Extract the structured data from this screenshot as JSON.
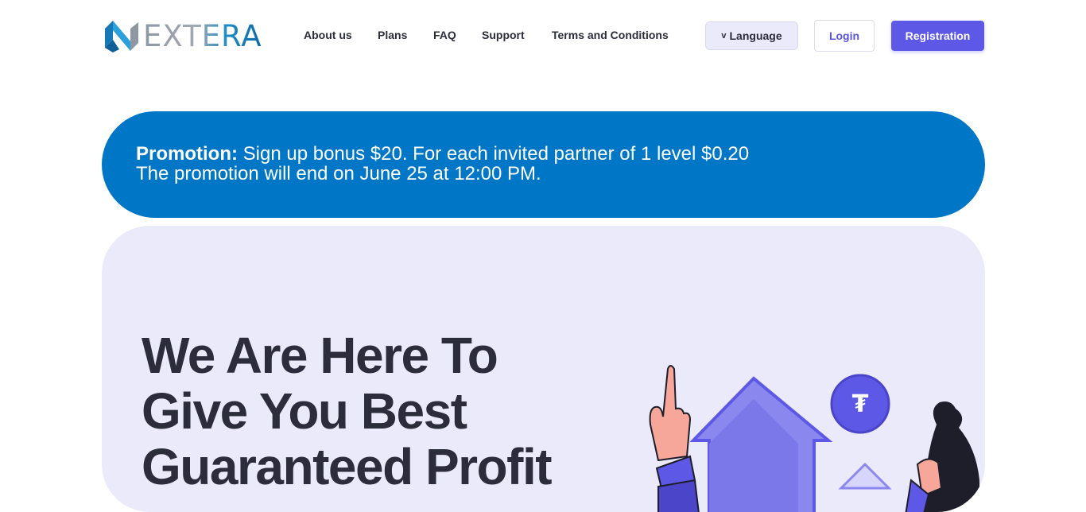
{
  "header": {
    "logo_text": "EXTERA",
    "nav": [
      {
        "label": "About us"
      },
      {
        "label": "Plans"
      },
      {
        "label": "FAQ"
      },
      {
        "label": "Support"
      },
      {
        "label": "Terms and Conditions"
      }
    ],
    "language_label": "Language",
    "language_icon": "chevron-down-icon",
    "login_label": "Login",
    "registration_label": "Registration"
  },
  "promo": {
    "label": "Promotion:",
    "text": " Sign up bonus $20. For each invited partner of 1 level $0.20",
    "end_text": "The promotion will end on June 25 at 12:00 PM."
  },
  "hero": {
    "title_lines": [
      "We Are Here To",
      "Give You Best",
      "Guaranteed Profit"
    ]
  },
  "colors": {
    "accent": "#5d58e6",
    "promo_bg": "#0077c6",
    "hero_bg": "#ebeafa",
    "text": "#2b2d3a"
  },
  "icons": {
    "logo": "extera-logo-icon",
    "coin": "tether-coin-icon",
    "house": "house-icon",
    "hand": "pointing-hand-icon",
    "bag": "money-bag-icon"
  }
}
